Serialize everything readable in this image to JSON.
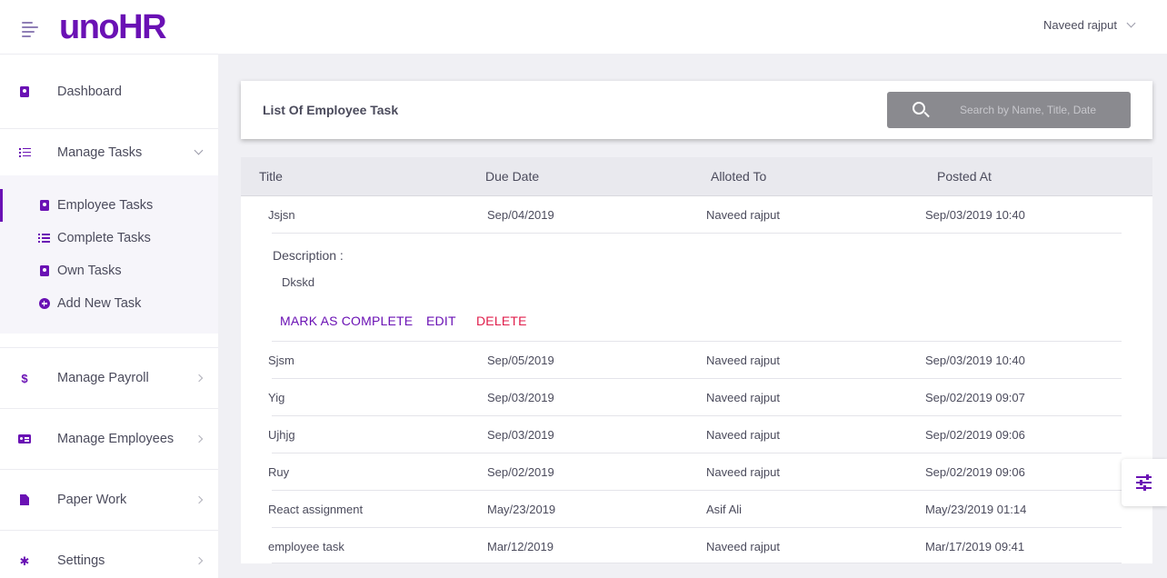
{
  "app": {
    "logo": "unoHR"
  },
  "header": {
    "user_name": "Naveed rajput"
  },
  "sidebar": {
    "dashboard": "Dashboard",
    "manage_tasks": "Manage Tasks",
    "sub": {
      "employee_tasks": "Employee Tasks",
      "complete_tasks": "Complete Tasks",
      "own_tasks": "Own Tasks",
      "add_new_task": "Add New Task"
    },
    "manage_payroll": "Manage Payroll",
    "manage_employees": "Manage Employees",
    "paper_work": "Paper Work",
    "settings": "Settings"
  },
  "main": {
    "title": "List Of Employee Task",
    "search_placeholder": "Search by Name, Title, Date",
    "columns": {
      "title": "Title",
      "due": "Due Date",
      "alloted": "Alloted To",
      "posted": "Posted At"
    },
    "rows": [
      {
        "title": "Jsjsn",
        "due": "Sep/04/2019",
        "alloted": "Naveed rajput",
        "posted": "Sep/03/2019 10:40"
      },
      {
        "title": "Sjsm",
        "due": "Sep/05/2019",
        "alloted": "Naveed rajput",
        "posted": "Sep/03/2019 10:40"
      },
      {
        "title": "Yig",
        "due": "Sep/03/2019",
        "alloted": "Naveed rajput",
        "posted": "Sep/02/2019 09:07"
      },
      {
        "title": "Ujhjg",
        "due": "Sep/03/2019",
        "alloted": "Naveed rajput",
        "posted": "Sep/02/2019 09:06"
      },
      {
        "title": "Ruy",
        "due": "Sep/02/2019",
        "alloted": "Naveed rajput",
        "posted": "Sep/02/2019 09:06"
      },
      {
        "title": "React assignment",
        "due": "May/23/2019",
        "alloted": "Asif Ali",
        "posted": "May/23/2019 01:14"
      },
      {
        "title": "employee task",
        "due": "Mar/12/2019",
        "alloted": "Naveed rajput",
        "posted": "Mar/17/2019 09:41"
      }
    ],
    "expanded": {
      "description_label": "Description :",
      "description_text": "Dkskd",
      "mark_complete": "MARK AS COMPLETE",
      "edit": "EDIT",
      "delete": "DELETE"
    }
  },
  "colors": {
    "brand": "#6a11b4",
    "danger": "#e01e4b"
  }
}
